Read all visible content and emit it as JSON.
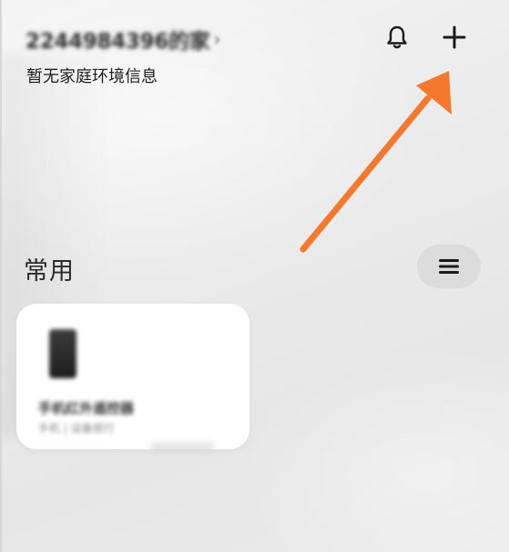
{
  "header": {
    "home_name": "2244984396的家",
    "home_chevron": "›",
    "env_info": "暂无家庭环境信息",
    "bell_icon": "bell-icon",
    "add_icon": "plus-icon"
  },
  "section": {
    "title": "常用",
    "menu_icon": "menu-icon"
  },
  "device_card": {
    "name": "手机红外遥控器",
    "status": "手机 | 设备很行",
    "image_icon": "phone-device-icon"
  },
  "annotation": {
    "arrow_color": "#F5782D"
  },
  "colors": {
    "background": "#ECECEC",
    "card": "#FFFFFF",
    "menu_button_bg": "#DCDCDC",
    "text_primary": "#1F1F1F"
  }
}
